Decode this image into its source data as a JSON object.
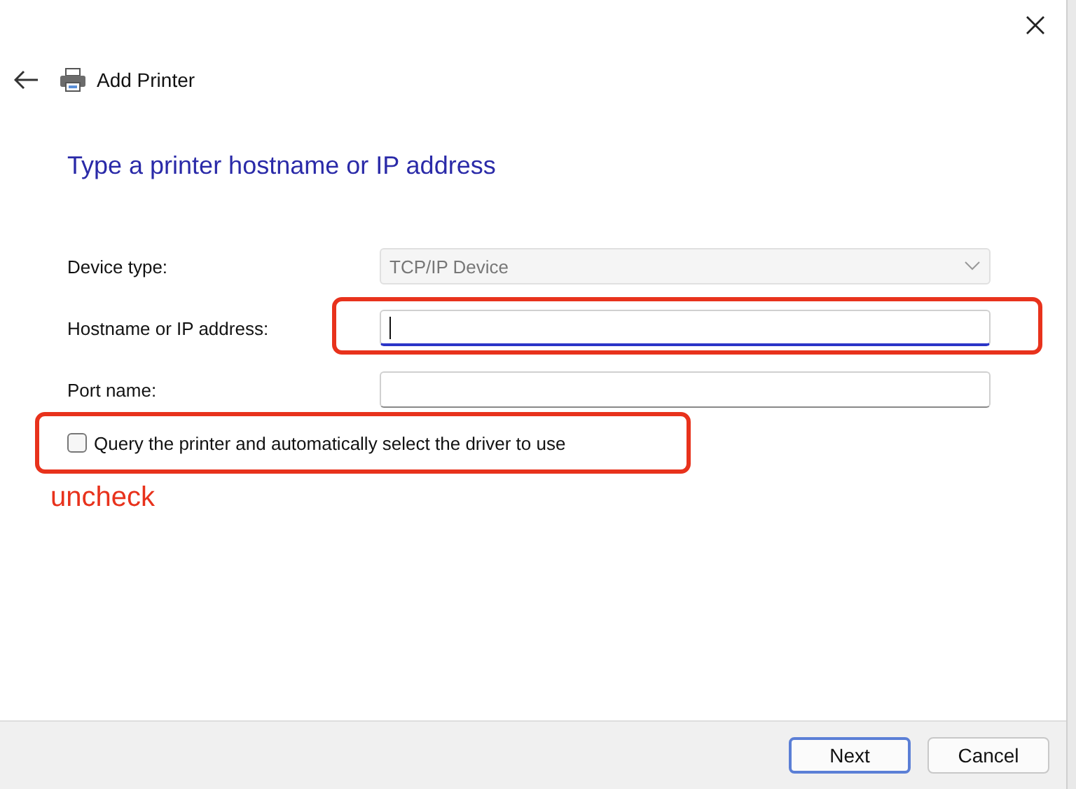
{
  "window": {
    "title": "Add Printer"
  },
  "heading": "Type a printer hostname or IP address",
  "fields": [
    {
      "label": "Device type:",
      "kind": "dropdown",
      "value": "TCP/IP Device",
      "disabled": true,
      "focused": false
    },
    {
      "label": "Hostname or IP address:",
      "kind": "text",
      "focused": true,
      "disabled": false
    },
    {
      "label": "Port name:",
      "kind": "text",
      "focused": false,
      "disabled": false
    }
  ],
  "checkbox": {
    "label": "Query the printer and automatically select the driver to use",
    "checked": false
  },
  "annotation": {
    "note": "uncheck"
  },
  "buttons": [
    {
      "label": "Next",
      "kind": "default"
    },
    {
      "label": "Cancel",
      "kind": "normal"
    }
  ]
}
